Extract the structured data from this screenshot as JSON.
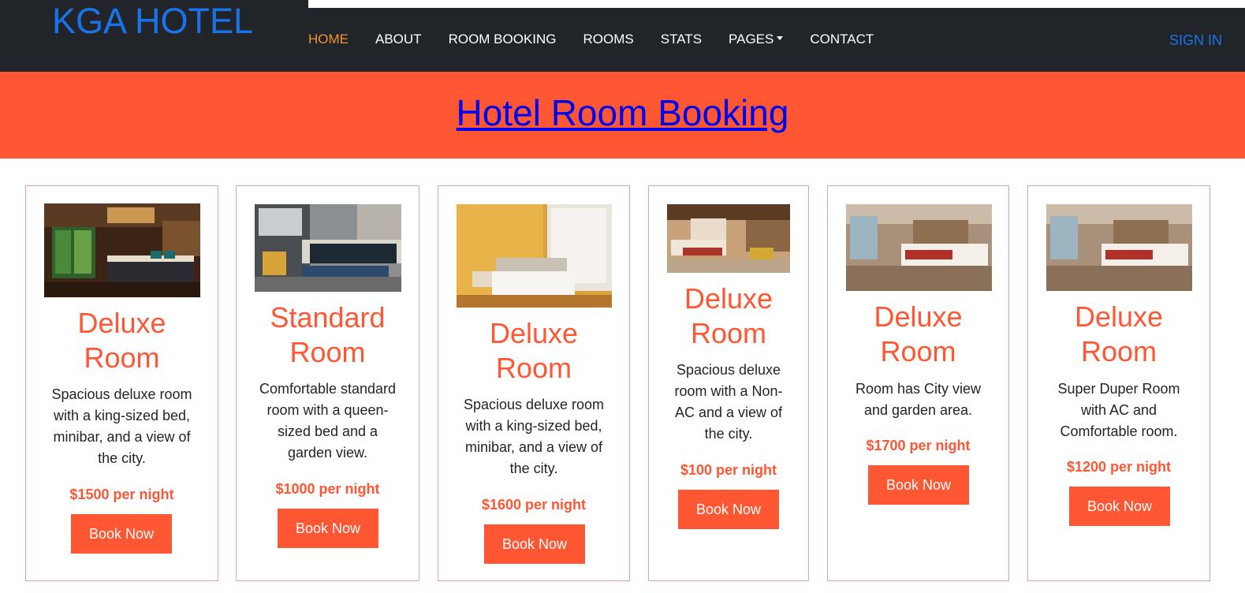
{
  "header": {
    "brand": "KGA HOTEL",
    "nav": [
      {
        "label": "HOME",
        "active": true
      },
      {
        "label": "ABOUT"
      },
      {
        "label": "ROOM BOOKING"
      },
      {
        "label": "ROOMS"
      },
      {
        "label": "STATS"
      },
      {
        "label": "PAGES",
        "dropdown": true
      },
      {
        "label": "CONTACT"
      }
    ],
    "signin": "SIGN IN"
  },
  "banner": {
    "title": "Hotel Room Booking"
  },
  "rooms": [
    {
      "title_line1": "Deluxe",
      "title_line2": "Room",
      "description": "Spacious deluxe room with a king-sized bed, minibar, and a view of the city.",
      "price": "$1500 per night",
      "button": "Book Now",
      "image": "dark-wood-bedroom-photo"
    },
    {
      "title_line1": "Standard",
      "title_line2": "Room",
      "description": "Comfortable standard room with a queen-sized bed and a garden view.",
      "price": "$1000 per night",
      "button": "Book Now",
      "image": "modern-grey-bedroom-photo"
    },
    {
      "title_line1": "Deluxe",
      "title_line2": "Room",
      "description": "Spacious deluxe room with a king-sized bed, minibar, and a view of the city.",
      "price": "$1600 per night",
      "button": "Book Now",
      "image": "bright-yellow-bedroom-photo"
    },
    {
      "title_line1": "Deluxe",
      "title_line2": "Room",
      "description": "Spacious deluxe room with a Non-AC and a view of the city.",
      "price": "$100 per night",
      "button": "Book Now",
      "image": "suite-bedroom-photo"
    },
    {
      "title_line1": "Deluxe",
      "title_line2": "Room",
      "description": "Room has City view and garden area.",
      "price": "$1700 per night",
      "button": "Book Now",
      "image": "hotel-bedroom-red-runner-photo"
    },
    {
      "title_line1": "Deluxe",
      "title_line2": "Room",
      "description": "Super Duper Room with AC and Comfortable room.",
      "price": "$1200 per night",
      "button": "Book Now",
      "image": "hotel-bedroom-red-runner-photo"
    }
  ],
  "colors": {
    "navbar": "#212529",
    "accent": "#ff5733",
    "brand": "#1a73e8",
    "active_nav": "#f0932b",
    "link": "#0000ee",
    "card_border": "#e5a3a3"
  }
}
